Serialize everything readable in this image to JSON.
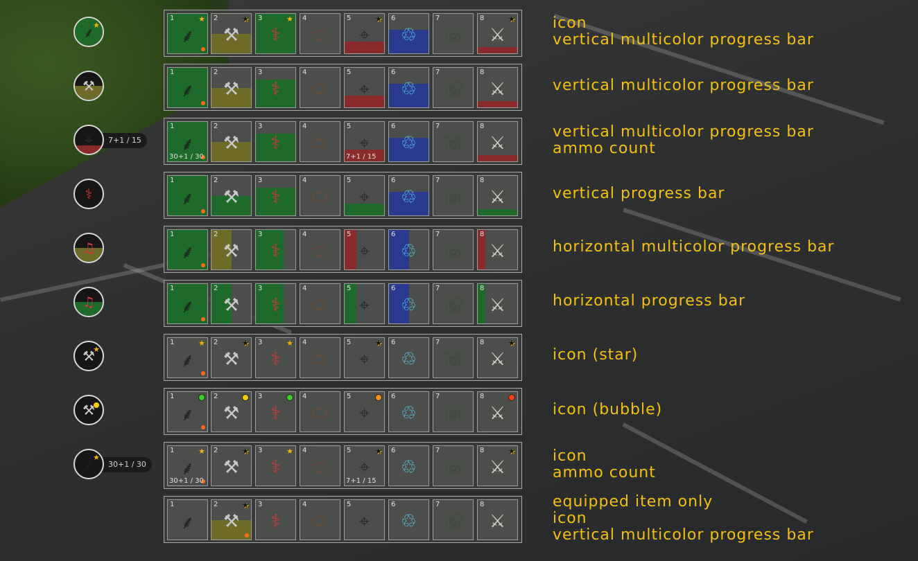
{
  "colors": {
    "label": "#f3c20d",
    "green": "#1e6a2a",
    "yellow": "#6e6b28",
    "red": "#8a2a2a",
    "blue": "#2a3a8e",
    "star_gold": "#f5b400",
    "star_black": "#111111",
    "dot_orange": "#ff6a1a"
  },
  "slot_icons": [
    "rifle-icon",
    "axe-icon",
    "pipe-wrench-icon",
    "belt-icon",
    "pistol-icon",
    "water-bottle-icon",
    "walkie-talkie-icon",
    "knife-icon"
  ],
  "rows": [
    {
      "labels": [
        "icon",
        "vertical multicolor progress bar"
      ],
      "circle": {
        "icon": "rifle-icon",
        "fill": "green",
        "fill_fraction": 1.0,
        "star": true,
        "bubble": false,
        "ammo": ""
      },
      "slots": [
        {
          "n": "1",
          "fill": "green",
          "mode": "v",
          "level": 1.0,
          "star": "gold",
          "dot": true
        },
        {
          "n": "2",
          "fill": "yellow",
          "mode": "v",
          "level": 0.5,
          "star": "black"
        },
        {
          "n": "3",
          "fill": "green",
          "mode": "v",
          "level": 1.0,
          "star": "gold"
        },
        {
          "n": "4"
        },
        {
          "n": "5",
          "fill": "red",
          "mode": "v",
          "level": 0.3,
          "star": "black"
        },
        {
          "n": "6",
          "fill": "blue",
          "mode": "v",
          "level": 0.6
        },
        {
          "n": "7"
        },
        {
          "n": "8",
          "fill": "red",
          "mode": "v",
          "level": 0.15,
          "star": "black"
        }
      ]
    },
    {
      "labels": [
        "vertical multicolor progress bar"
      ],
      "circle": {
        "icon": "axe-icon",
        "fill": "yellow",
        "fill_fraction": 0.5,
        "star": false,
        "bubble": false,
        "ammo": ""
      },
      "slots": [
        {
          "n": "1",
          "fill": "green",
          "mode": "v",
          "level": 1.0,
          "dot": true
        },
        {
          "n": "2",
          "fill": "yellow",
          "mode": "v",
          "level": 0.5
        },
        {
          "n": "3",
          "fill": "green",
          "mode": "v",
          "level": 0.7
        },
        {
          "n": "4"
        },
        {
          "n": "5",
          "fill": "red",
          "mode": "v",
          "level": 0.3
        },
        {
          "n": "6",
          "fill": "blue",
          "mode": "v",
          "level": 0.6
        },
        {
          "n": "7"
        },
        {
          "n": "8",
          "fill": "red",
          "mode": "v",
          "level": 0.15
        }
      ]
    },
    {
      "labels": [
        "vertical multicolor progress bar",
        "ammo count"
      ],
      "circle": {
        "icon": "pistol-icon",
        "fill": "red",
        "fill_fraction": 0.3,
        "star": false,
        "bubble": false,
        "ammo": "7+1 / 15"
      },
      "slots": [
        {
          "n": "1",
          "fill": "green",
          "mode": "v",
          "level": 1.0,
          "dot": true,
          "ammo": "30+1 / 30"
        },
        {
          "n": "2",
          "fill": "yellow",
          "mode": "v",
          "level": 0.5
        },
        {
          "n": "3",
          "fill": "green",
          "mode": "v",
          "level": 0.7
        },
        {
          "n": "4"
        },
        {
          "n": "5",
          "fill": "red",
          "mode": "v",
          "level": 0.3,
          "ammo": "7+1 / 15"
        },
        {
          "n": "6",
          "fill": "blue",
          "mode": "v",
          "level": 0.6
        },
        {
          "n": "7"
        },
        {
          "n": "8",
          "fill": "red",
          "mode": "v",
          "level": 0.15
        }
      ]
    },
    {
      "labels": [
        "vertical progress bar"
      ],
      "circle": {
        "icon": "pipe-wrench-icon",
        "fill": "green",
        "fill_fraction": 0.0,
        "star": false,
        "bubble": false,
        "ammo": ""
      },
      "slots": [
        {
          "n": "1",
          "fill": "green",
          "mode": "v",
          "level": 1.0,
          "dot": true
        },
        {
          "n": "2",
          "fill": "green",
          "mode": "v",
          "level": 0.5
        },
        {
          "n": "3",
          "fill": "green",
          "mode": "v",
          "level": 0.7
        },
        {
          "n": "4"
        },
        {
          "n": "5",
          "fill": "green",
          "mode": "v",
          "level": 0.3
        },
        {
          "n": "6",
          "fill": "blue",
          "mode": "v",
          "level": 0.6
        },
        {
          "n": "7"
        },
        {
          "n": "8",
          "fill": "green",
          "mode": "v",
          "level": 0.15
        }
      ]
    },
    {
      "labels": [
        "horizontal multicolor progress bar"
      ],
      "circle": {
        "icon": "guitar-icon",
        "fill": "yellow",
        "fill_fraction": 0.5,
        "star": false,
        "bubble": false,
        "ammo": ""
      },
      "slots": [
        {
          "n": "1",
          "fill": "green",
          "mode": "h",
          "level": 1.0,
          "dot": true
        },
        {
          "n": "2",
          "fill": "yellow",
          "mode": "h",
          "level": 0.5
        },
        {
          "n": "3",
          "fill": "green",
          "mode": "h",
          "level": 0.7
        },
        {
          "n": "4"
        },
        {
          "n": "5",
          "fill": "red",
          "mode": "h",
          "level": 0.3
        },
        {
          "n": "6",
          "fill": "blue",
          "mode": "h",
          "level": 0.5
        },
        {
          "n": "7"
        },
        {
          "n": "8",
          "fill": "red",
          "mode": "h",
          "level": 0.2
        }
      ]
    },
    {
      "labels": [
        "horizontal progress bar"
      ],
      "circle": {
        "icon": "guitar-icon",
        "fill": "green",
        "fill_fraction": 0.5,
        "star": false,
        "bubble": false,
        "ammo": ""
      },
      "slots": [
        {
          "n": "1",
          "fill": "green",
          "mode": "h",
          "level": 1.0,
          "dot": true
        },
        {
          "n": "2",
          "fill": "green",
          "mode": "h",
          "level": 0.5
        },
        {
          "n": "3",
          "fill": "green",
          "mode": "h",
          "level": 0.7
        },
        {
          "n": "4"
        },
        {
          "n": "5",
          "fill": "green",
          "mode": "h",
          "level": 0.3
        },
        {
          "n": "6",
          "fill": "blue",
          "mode": "h",
          "level": 0.5
        },
        {
          "n": "7"
        },
        {
          "n": "8",
          "fill": "green",
          "mode": "h",
          "level": 0.2
        }
      ]
    },
    {
      "labels": [
        "icon (star)"
      ],
      "circle": {
        "icon": "axe-icon",
        "fill": "",
        "fill_fraction": 0.0,
        "star": true,
        "bubble": false,
        "ammo": ""
      },
      "slots": [
        {
          "n": "1",
          "star": "gold",
          "dot": true
        },
        {
          "n": "2",
          "star": "black"
        },
        {
          "n": "3",
          "star": "gold"
        },
        {
          "n": "4"
        },
        {
          "n": "5",
          "star": "black"
        },
        {
          "n": "6"
        },
        {
          "n": "7"
        },
        {
          "n": "8",
          "star": "black"
        }
      ]
    },
    {
      "labels": [
        "icon (bubble)"
      ],
      "circle": {
        "icon": "axe-icon",
        "fill": "",
        "fill_fraction": 0.0,
        "star": false,
        "bubble": true,
        "ammo": ""
      },
      "slots": [
        {
          "n": "1",
          "bubble": "#3ccf2a",
          "dot": true
        },
        {
          "n": "2",
          "bubble": "#f5d000"
        },
        {
          "n": "3",
          "bubble": "#3ccf2a"
        },
        {
          "n": "4"
        },
        {
          "n": "5",
          "bubble": "#ff8c1a"
        },
        {
          "n": "6"
        },
        {
          "n": "7"
        },
        {
          "n": "8",
          "bubble": "#ff3a1a"
        }
      ]
    },
    {
      "labels": [
        "icon",
        "ammo count"
      ],
      "circle": {
        "icon": "rifle-icon",
        "fill": "",
        "fill_fraction": 0.0,
        "star": true,
        "bubble": false,
        "ammo": "30+1 / 30"
      },
      "slots": [
        {
          "n": "1",
          "star": "gold",
          "dot": true,
          "ammo": "30+1 / 30"
        },
        {
          "n": "2",
          "star": "black"
        },
        {
          "n": "3",
          "star": "gold"
        },
        {
          "n": "4"
        },
        {
          "n": "5",
          "star": "black",
          "ammo": "7+1 / 15"
        },
        {
          "n": "6"
        },
        {
          "n": "7"
        },
        {
          "n": "8",
          "star": "black"
        }
      ]
    },
    {
      "labels": [
        "equipped item only",
        "icon",
        "vertical multicolor progress bar"
      ],
      "circle": null,
      "slots": [
        {
          "n": "1"
        },
        {
          "n": "2",
          "fill": "yellow",
          "mode": "v",
          "level": 0.5,
          "star": "black",
          "dot": true
        },
        {
          "n": "3"
        },
        {
          "n": "4"
        },
        {
          "n": "5"
        },
        {
          "n": "6"
        },
        {
          "n": "7"
        },
        {
          "n": "8"
        }
      ]
    }
  ]
}
